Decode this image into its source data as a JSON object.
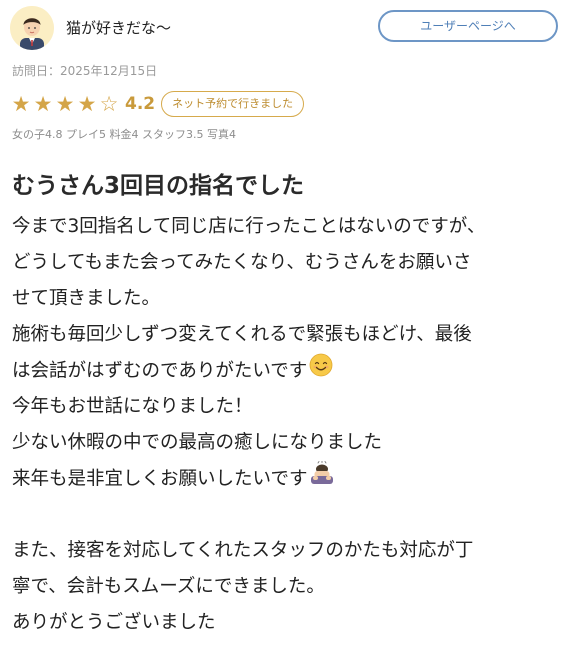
{
  "header": {
    "username": "猫が好きだな〜",
    "user_page_label": "ユーザーページへ",
    "avatar_icon": "person-avatar-icon"
  },
  "visit": {
    "date_label": "訪問日：2025年12月15日"
  },
  "rating": {
    "value": 4.2,
    "score_text": "4.2",
    "filled_stars": 4,
    "total_stars": 5,
    "badge": "ネット予約で行きました",
    "sub_scores": "女の子4.8 プレイ5 料金4 スタッフ3.5 写真4"
  },
  "review": {
    "title": "むうさん3回目の指名でした",
    "line1": "今まで3回指名して同じ店に行ったことはないのですが、",
    "line2": "どうしてもまた会ってみたくなり、むうさんをお願いさ",
    "line3": "せて頂きました。",
    "line4": "施術も毎回少しずつ変えてくれるで緊張もほどけ、最後",
    "line5": "は会話がはずむのでありがたいです",
    "line6": "今年もお世話になりました！",
    "line7": "少ない休暇の中での最高の癒しになりました",
    "line8": "来年も是非宜しくお願いしたいです",
    "line9": "また、接客を対応してくれたスタッフのかたも対応が丁",
    "line10": "寧で、会計もスムーズにできました。",
    "line11": "ありがとうございました"
  },
  "icons": {
    "smile": "smiling-face-icon",
    "bow": "bowing-person-icon"
  },
  "colors": {
    "star": "#d4a548",
    "score": "#c99a3b",
    "button_border": "#6d96c6",
    "button_text": "#4f7fb7",
    "muted_text": "#9a9a9a"
  }
}
